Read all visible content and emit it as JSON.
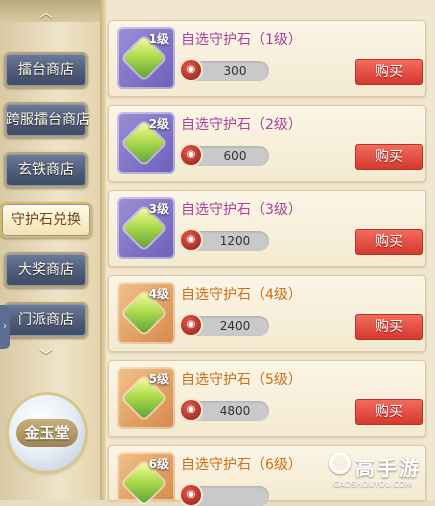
{
  "sidebar": {
    "tabs": [
      {
        "label": "擂台商店",
        "active": false
      },
      {
        "label": "跨服擂台商店",
        "active": false
      },
      {
        "label": "玄铁商店",
        "active": false
      },
      {
        "label": "守护石兑换",
        "active": true
      },
      {
        "label": "大奖商店",
        "active": false
      },
      {
        "label": "门派商店",
        "active": false
      }
    ],
    "scroll_up_icon": "chevron-up-icon",
    "scroll_down_icon": "chevron-down-icon",
    "side_expand_icon": "chevron-right-icon",
    "medal_label": "金玉堂"
  },
  "items": [
    {
      "name": "自选守护石（1级）",
      "level_badge": "1级",
      "price": "300",
      "buy_label": "购买",
      "frame": "purple"
    },
    {
      "name": "自选守护石（2级）",
      "level_badge": "2级",
      "price": "600",
      "buy_label": "购买",
      "frame": "purple"
    },
    {
      "name": "自选守护石（3级）",
      "level_badge": "3级",
      "price": "1200",
      "buy_label": "购买",
      "frame": "purple"
    },
    {
      "name": "自选守护石（4级）",
      "level_badge": "4级",
      "price": "2400",
      "buy_label": "购买",
      "frame": "orange"
    },
    {
      "name": "自选守护石（5级）",
      "level_badge": "5级",
      "price": "4800",
      "buy_label": "购买",
      "frame": "orange"
    },
    {
      "name": "自选守护石（6级）",
      "level_badge": "6级",
      "price": "",
      "buy_label": "",
      "frame": "orange"
    }
  ],
  "currency_icon": "red-coin-icon",
  "watermark": {
    "title": "高手游",
    "subtitle": "GAOSHOUYOU.COM"
  },
  "colors": {
    "purple_name": "#a4459a",
    "orange_name": "#c8701a",
    "buy_button": "#e0473b",
    "tab_bg": "#56627e"
  }
}
